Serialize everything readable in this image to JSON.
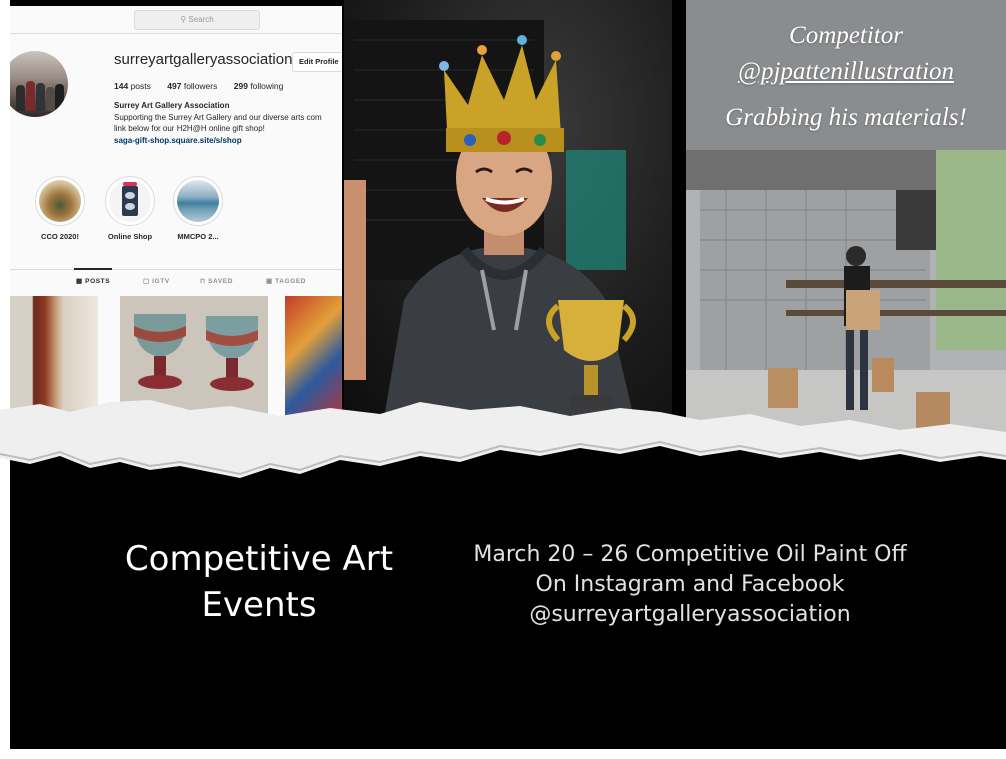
{
  "instagram": {
    "search_placeholder": "Search",
    "username": "surreyartgalleryassociation",
    "edit_profile": "Edit Profile",
    "stats": {
      "posts": "144",
      "posts_label": "posts",
      "followers": "497",
      "followers_label": "followers",
      "following": "299",
      "following_label": "following"
    },
    "display_name": "Surrey Art Gallery Association",
    "bio_line1": "Supporting the Surrey Art Gallery and our diverse arts com",
    "bio_line2": "link below for our H2H@H online gift shop!",
    "link": "saga-gift-shop.square.site/s/shop",
    "highlights": [
      {
        "label": "CCO 2020!"
      },
      {
        "label": "Online Shop"
      },
      {
        "label": "MMCPO 2..."
      }
    ],
    "tabs": [
      {
        "label": "POSTS"
      },
      {
        "label": "IGTV"
      },
      {
        "label": "SAVED"
      },
      {
        "label": "TAGGED"
      }
    ]
  },
  "story": {
    "line1": "Competitor",
    "line2": "@pjpattenillustration",
    "line3": "Grabbing his materials!"
  },
  "slide": {
    "title_line1": "Competitive Art",
    "title_line2": "Events",
    "info_line1": "March 20 – 26 Competitive Oil Paint Off",
    "info_line2": "On Instagram and Facebook",
    "info_line3": "@surreyartgalleryassociation"
  },
  "colors": {
    "background": "#000000",
    "paper": "#f2f2f2",
    "instagram_link": "#00376b"
  }
}
